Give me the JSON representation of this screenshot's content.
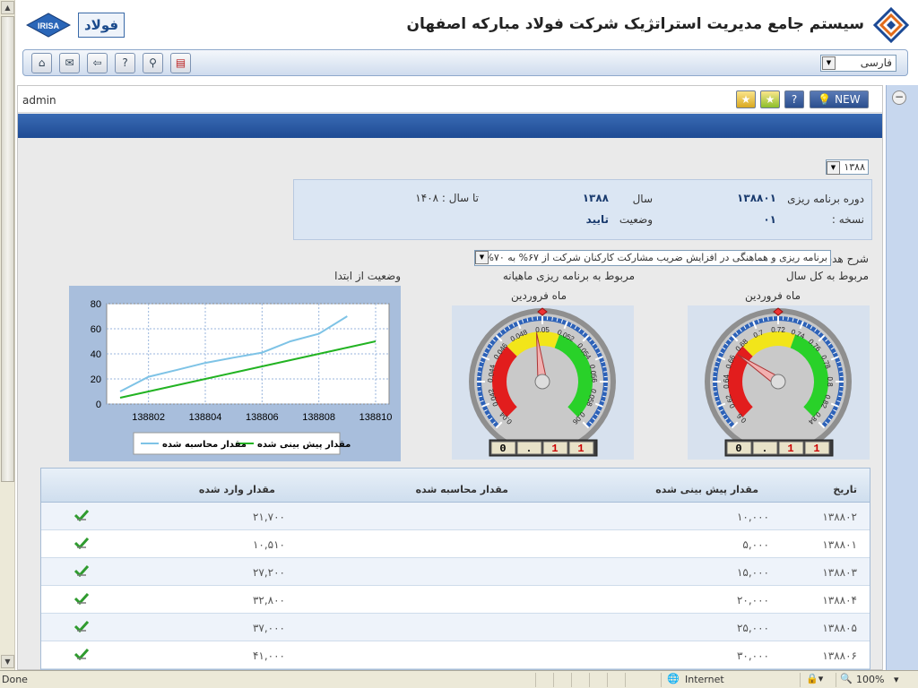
{
  "header": {
    "title": "سیستم جامع مدیریت استراتژیک شرکت فولاد مبارکه اصفهان",
    "irisa_logo": "IRISA",
    "fofo_logo": "فولاد"
  },
  "toolbar": {
    "buttons": [
      "home-icon",
      "mail-icon",
      "back-icon",
      "help-icon",
      "search-icon",
      "book-icon"
    ],
    "language": "فارسی"
  },
  "admin_bar": {
    "user": "admin",
    "new_label": "NEW",
    "help_label": "?"
  },
  "filters": {
    "year": "۱۳۸۸"
  },
  "info": {
    "period_label": "دوره برنامه ریزی",
    "period_value": "۱۳۸۸۰۱",
    "year_label": "سال",
    "year_value": "۱۳۸۸",
    "to_year": "تا سال : ۱۴۰۸",
    "version_label": "نسخه :",
    "version_value": "۰۱",
    "status_label": "وضعیت",
    "status_value": "تایید"
  },
  "goal": {
    "label": "شرح هدف",
    "value": "برنامه ریزی و هماهنگی در افزایش ضریب مشارکت کارکنان شرکت از ۶۷% به ۷۰%"
  },
  "sections": {
    "yearly": "مربوط به کل سال",
    "monthly": "مربوط به برنامه ریزی ماهیانه",
    "from_start": "وضعیت از ابتدا",
    "month_label_1": "ماه فروردین",
    "month_label_2": "ماه فروردین"
  },
  "gauges": [
    {
      "name": "gauge-yearly",
      "ticks": [
        "0.6",
        "0.62",
        "0.64",
        "0.66",
        "0.68",
        "0.7",
        "0.72",
        "0.74",
        "0.76",
        "0.78",
        "0.8",
        "0.82",
        "0.84"
      ],
      "min": 0.6,
      "max": 0.84,
      "value": 0.67,
      "readout": [
        "0",
        ".",
        "1",
        "1"
      ]
    },
    {
      "name": "gauge-monthly",
      "ticks": [
        "0.04",
        "0.042",
        "0.044",
        "0.046",
        "0.048",
        "0.05",
        "0.052",
        "0.054",
        "0.056",
        "0.058",
        "0.06"
      ],
      "min": 0.04,
      "max": 0.06,
      "value": 0.0495,
      "readout": [
        "0",
        ".",
        "1",
        "1"
      ]
    }
  ],
  "chart_data": {
    "type": "line",
    "x": [
      "138801",
      "138802",
      "138803",
      "138804",
      "138805",
      "138806",
      "138807",
      "138808",
      "138809",
      "138810"
    ],
    "xticks": [
      "138802",
      "138804",
      "138806",
      "138808",
      "138810"
    ],
    "ylim": [
      0,
      80
    ],
    "yticks": [
      0,
      20,
      40,
      60,
      80
    ],
    "series": [
      {
        "name": "مقدار محاسبه شده",
        "color": "#7ec3e6",
        "values": [
          10,
          21.7,
          27.2,
          32.8,
          37,
          41,
          50,
          56,
          70,
          null
        ]
      },
      {
        "name": "مقدار پیش بینی شده",
        "color": "#22b322",
        "values": [
          5,
          10,
          15,
          20,
          25,
          30,
          35,
          40,
          45,
          50
        ]
      }
    ],
    "grid": true,
    "legend": "bottom"
  },
  "table": {
    "headers": [
      "تاریخ",
      "مقدار پیش بینی شده",
      "مقدار محاسبه شده",
      "مقدار وارد شده"
    ],
    "rows": [
      {
        "date": "۱۳۸۸۰۲",
        "forecast": "۱۰,۰۰۰",
        "calculated": "",
        "entered": "۲۱,۷۰۰"
      },
      {
        "date": "۱۳۸۸۰۱",
        "forecast": "۵,۰۰۰",
        "calculated": "",
        "entered": "۱۰,۵۱۰"
      },
      {
        "date": "۱۳۸۸۰۳",
        "forecast": "۱۵,۰۰۰",
        "calculated": "",
        "entered": "۲۷,۲۰۰"
      },
      {
        "date": "۱۳۸۸۰۴",
        "forecast": "۲۰,۰۰۰",
        "calculated": "",
        "entered": "۳۲,۸۰۰"
      },
      {
        "date": "۱۳۸۸۰۵",
        "forecast": "۲۵,۰۰۰",
        "calculated": "",
        "entered": "۳۷,۰۰۰"
      },
      {
        "date": "۱۳۸۸۰۶",
        "forecast": "۳۰,۰۰۰",
        "calculated": "",
        "entered": "۴۱,۰۰۰"
      }
    ]
  },
  "statusbar": {
    "left": "Done",
    "zone": "Internet",
    "zoom": "100%"
  }
}
